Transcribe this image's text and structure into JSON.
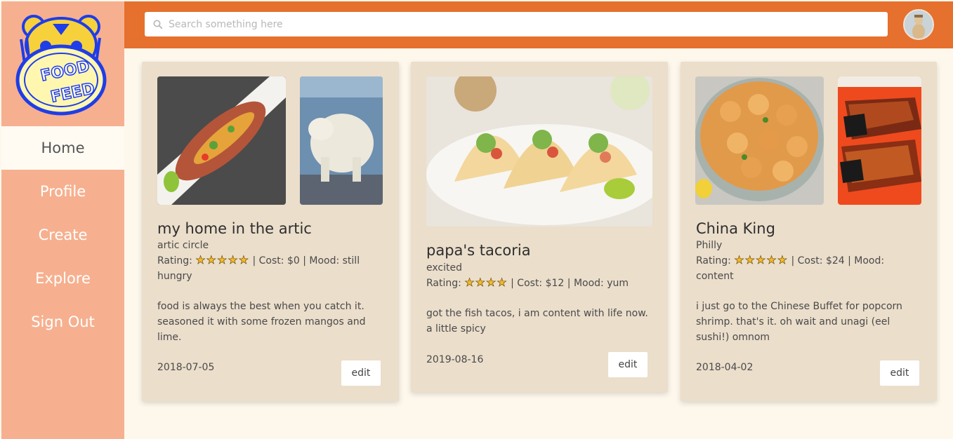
{
  "brand": {
    "logo_text_top": "FOOD",
    "logo_text_bottom": "FEED"
  },
  "sidebar": {
    "items": [
      {
        "label": "Home",
        "active": true
      },
      {
        "label": "Profile"
      },
      {
        "label": "Create"
      },
      {
        "label": "Explore"
      },
      {
        "label": "Sign Out"
      }
    ]
  },
  "search": {
    "placeholder": "Search something here",
    "value": ""
  },
  "colors": {
    "accent": "#e6702e",
    "sidebar": "#f6b08f",
    "card": "#ebdecb",
    "background": "#fef8ec",
    "star": "#f7b92a"
  },
  "posts": [
    {
      "title": "my home in the artic",
      "location": "artic circle",
      "rating_label": "Rating:",
      "stars": 5,
      "star_text": "★★★★★",
      "meta_rest": "| Cost: $0 | Mood: still hungry",
      "description": "food is always the best when you catch it. seasoned it with some frozen mangos and lime.",
      "date": "2018-07-05",
      "edit_label": "edit",
      "images": [
        "fish-with-mango-salsa",
        "polar-bear"
      ]
    },
    {
      "title": "papa's tacoria",
      "location": "excited",
      "rating_label": "Rating:",
      "stars": 4,
      "star_text": "★★★★",
      "meta_rest": "| Cost: $12 | Mood: yum",
      "description": "got the fish tacos, i am content with life now. a little spicy",
      "date": "2019-08-16",
      "edit_label": "edit",
      "images": [
        "fish-tacos"
      ]
    },
    {
      "title": "China King",
      "location": "Philly",
      "rating_label": "Rating:",
      "stars": 5,
      "star_text": "★★★★★",
      "meta_rest": "| Cost: $24 | Mood: content",
      "description": "i just go to the Chinese Buffet for popcorn shrimp. that's it. oh wait and unagi (eel sushi!) omnom",
      "date": "2018-04-02",
      "edit_label": "edit",
      "images": [
        "popcorn-shrimp",
        "unagi-sushi"
      ]
    }
  ]
}
